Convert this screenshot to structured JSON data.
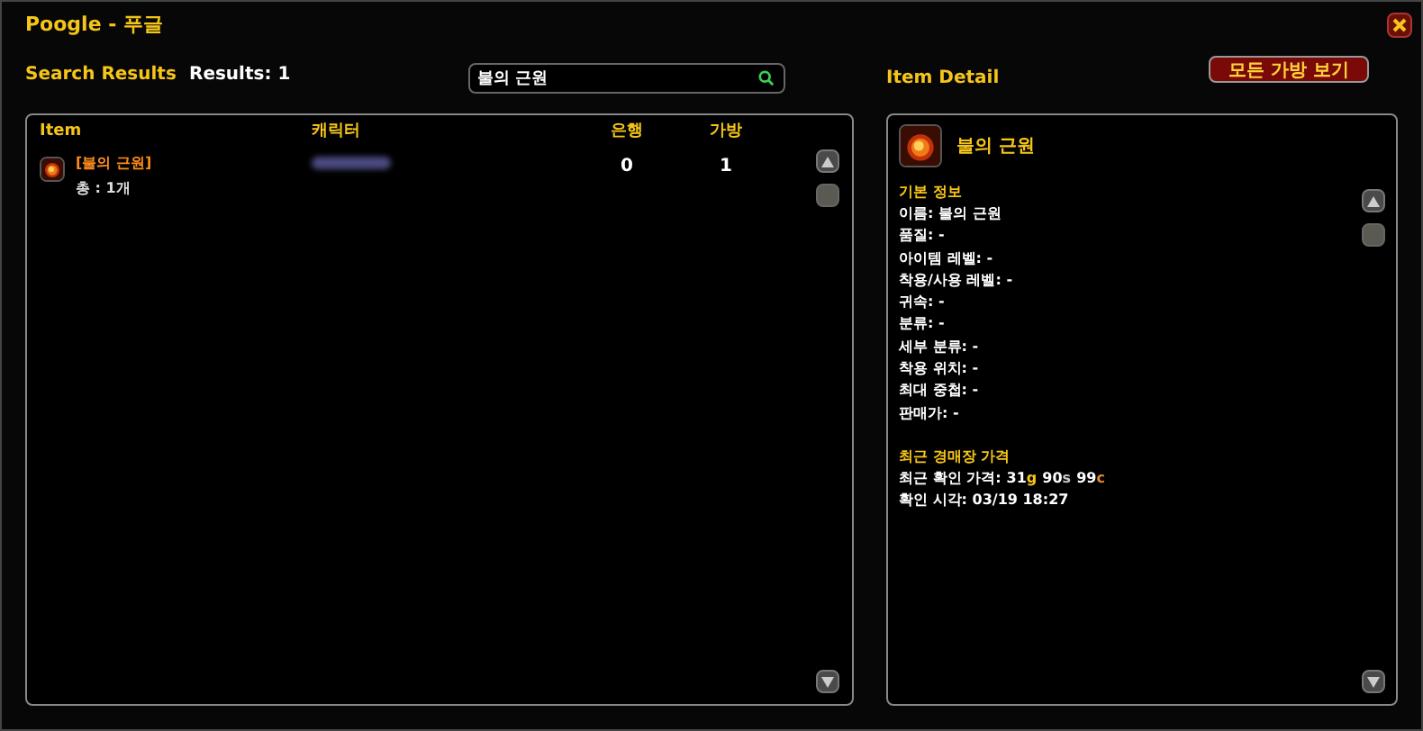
{
  "window": {
    "title": "Poogle - 푸글"
  },
  "search_results": {
    "heading": "Search Results",
    "count": "Results: 1",
    "search": {
      "value": "불의 근원"
    },
    "columns": [
      "Item",
      "캐릭터",
      "은행",
      "가방"
    ],
    "rows": [
      {
        "item": "[불의 근원]",
        "total": "총 : 1개",
        "bank": "0",
        "bag": "1"
      }
    ]
  },
  "item_detail": {
    "heading": "Item Detail",
    "view_all_button": "모든 가방 보기",
    "name": "불의 근원",
    "basic_info_title": "기본 정보",
    "fields": [
      "이름: 불의 근원",
      "품질: -",
      "아이템 레벨: -",
      "착용/사용 레벨: -",
      "귀속: -",
      "분류: -",
      "세부 분류: -",
      "착용 위치: -",
      "최대 중첩: -",
      "판매가: -"
    ],
    "auction_title": "최근 경매장 가격",
    "price_label": "최근 확인 가격:",
    "price": [
      {
        "amount": "31",
        "unit": "g",
        "kind": "gold"
      },
      {
        "amount": "90",
        "unit": "s",
        "kind": "silver"
      },
      {
        "amount": "99",
        "unit": "c",
        "kind": "copper"
      }
    ],
    "checked_time": "확인 시각: 03/19 18:27"
  }
}
